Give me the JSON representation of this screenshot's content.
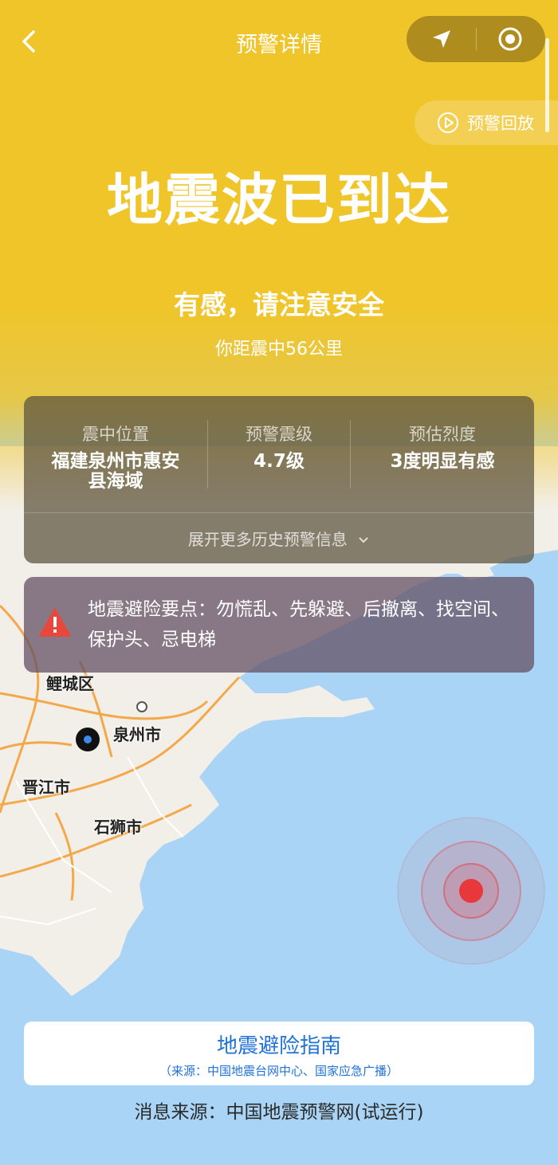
{
  "header": {
    "title": "预警详情"
  },
  "replay": {
    "label": "预警回放"
  },
  "alert": {
    "headline": "地震波已到达",
    "advice": "有感，请注意安全",
    "distance": "你距震中56公里"
  },
  "info": {
    "epicenter_label": "震中位置",
    "epicenter_value": "福建泉州市惠安县海域",
    "magnitude_label": "预警震级",
    "magnitude_value": "4.7级",
    "intensity_label": "预估烈度",
    "intensity_value": "3度明显有感",
    "expand_label": "展开更多历史预警信息"
  },
  "tips": {
    "text": "地震避险要点：勿慌乱、先躲避、后撤离、找空间、保护头、忌电梯"
  },
  "map": {
    "labels": [
      "鲤城区",
      "泉州市",
      "晋江市",
      "石狮市"
    ]
  },
  "guide": {
    "title": "地震避险指南",
    "source": "（来源：中国地震台网中心、国家应急广播）"
  },
  "footer": {
    "source": "消息来源：中国地震预警网(试运行)"
  },
  "colors": {
    "hero": "#f0c52a",
    "sea": "#a9d4f5",
    "land": "#f2efe8",
    "road": "#f5a84a",
    "link": "#1f73d8",
    "warning": "#e8483c",
    "epicenter": "#e8383c"
  }
}
